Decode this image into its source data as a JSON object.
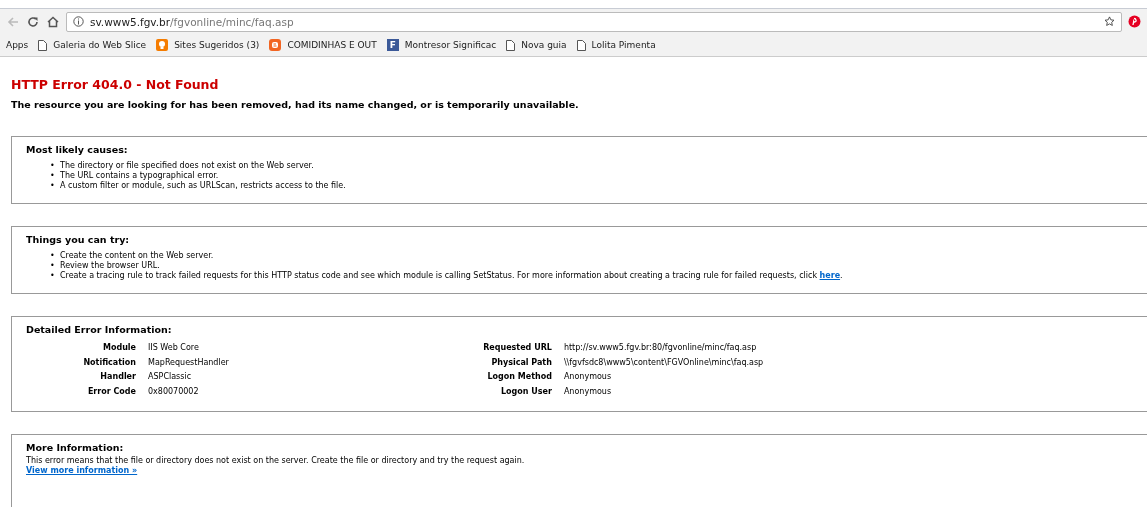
{
  "browser": {
    "address": {
      "host": "sv.www5.fgv.br",
      "path": "/fgvonline/minc/faq.asp"
    },
    "bookmarks": [
      {
        "label": "Apps",
        "kind": "apps"
      },
      {
        "label": "Galeria do Web Slice",
        "kind": "page"
      },
      {
        "label": "Sites Sugeridos (3)",
        "kind": "bulb"
      },
      {
        "label": "COMIDINHAS E OUT",
        "kind": "blog"
      },
      {
        "label": "Montresor Significac",
        "kind": "letter",
        "glyph": "F"
      },
      {
        "label": "Nova guia",
        "kind": "page"
      },
      {
        "label": "Lolita Pimenta",
        "kind": "page"
      }
    ]
  },
  "error": {
    "title": "HTTP Error 404.0 - Not Found",
    "subtitle": "The resource you are looking for has been removed, had its name changed, or is temporarily unavailable."
  },
  "causes": {
    "heading": "Most likely causes:",
    "items": [
      {
        "marker": "•",
        "text": "The directory or file specified does not exist on the Web server."
      },
      {
        "marker": "•",
        "text": "The URL contains a typographical error."
      },
      {
        "marker": "•",
        "text": "A custom filter or module, such as URLScan, restricts access to the file."
      }
    ]
  },
  "try": {
    "heading": "Things you can try:",
    "items": [
      {
        "marker": "•",
        "text": "Create the content on the Web server."
      },
      {
        "marker": "•",
        "text": "Review the browser URL."
      },
      {
        "marker": "•",
        "text": "Create a tracing rule to track failed requests for this HTTP status code and see which module is calling SetStatus. For more information about creating a tracing rule for failed requests, click ",
        "link": "here",
        "after": "."
      }
    ]
  },
  "details": {
    "heading": "Detailed Error Information:",
    "left": [
      {
        "label": "Module",
        "value": "IIS Web Core"
      },
      {
        "label": "Notification",
        "value": "MapRequestHandler"
      },
      {
        "label": "Handler",
        "value": "ASPClassic"
      },
      {
        "label": "Error Code",
        "value": "0x80070002"
      }
    ],
    "right": [
      {
        "label": "Requested URL",
        "value": "http://sv.www5.fgv.br:80/fgvonline/minc/faq.asp"
      },
      {
        "label": "Physical Path",
        "value": "\\\\fgvfsdc8\\www5\\content\\FGVOnline\\minc\\faq.asp"
      },
      {
        "label": "Logon Method",
        "value": "Anonymous"
      },
      {
        "label": "Logon User",
        "value": "Anonymous"
      }
    ]
  },
  "more": {
    "heading": "More Information:",
    "text": "This error means that the file or directory does not exist on the server. Create the file or directory and try the request again.",
    "link": "View more information »"
  }
}
